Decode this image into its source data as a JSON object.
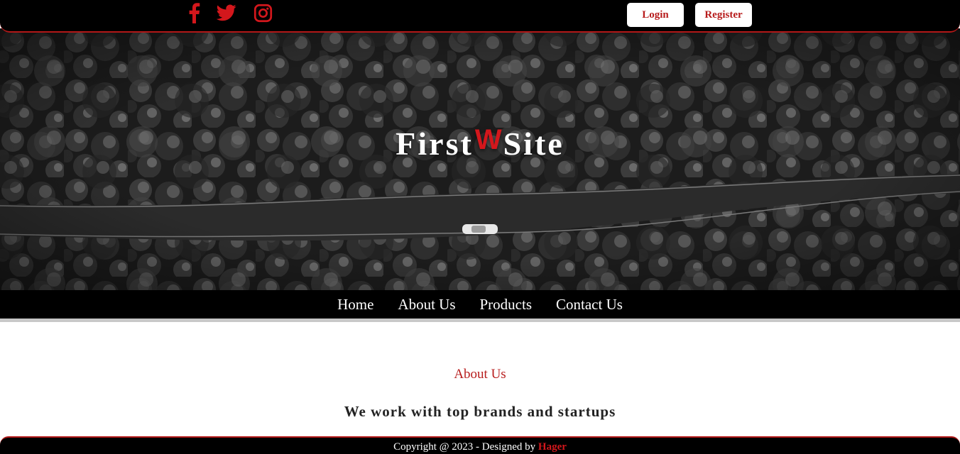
{
  "header": {
    "social": [
      {
        "icon": "facebook-icon"
      },
      {
        "icon": "twitter-icon"
      },
      {
        "icon": "instagram-icon"
      }
    ],
    "login_label": "Login",
    "register_label": "Register"
  },
  "hero": {
    "title_part1": "First",
    "title_mark": "W",
    "title_part2": "Site"
  },
  "nav": {
    "items": [
      "Home",
      "About Us",
      "Products",
      "Contact Us"
    ]
  },
  "about": {
    "label": "About Us",
    "heading": "We work with top brands and startups"
  },
  "footer": {
    "copyright": "Copyright @ 2023 - Designed by ",
    "author": "Hager"
  },
  "colors": {
    "accent": "#b71c1c",
    "bar": "#000000",
    "background": "#ffffff"
  }
}
